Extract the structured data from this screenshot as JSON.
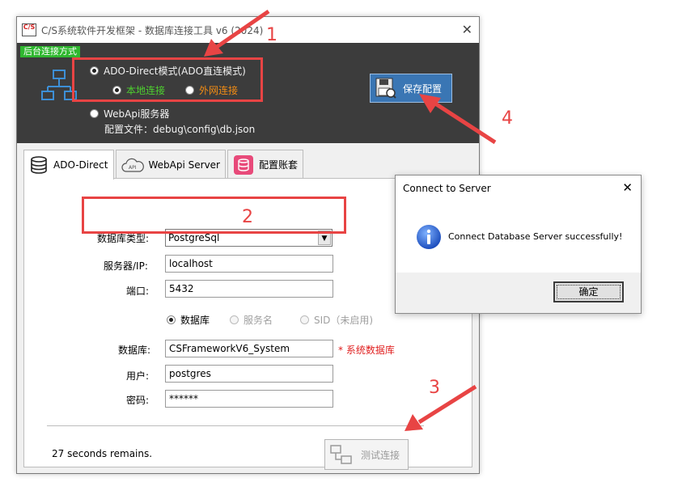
{
  "window": {
    "app_icon_text": "C/S",
    "title": "C/S系统软件开发框架 - 数据库连接工具 v6 (2024)",
    "close_glyph": "✕"
  },
  "header": {
    "mode_badge": "后台连接方式",
    "ado_direct_label": "ADO-Direct模式(ADO直连模式)",
    "local_label": "本地连接",
    "external_label": "外网连接",
    "webapi_label": "WebApi服务器",
    "config_file_line": "配置文件：debug\\config\\db.json",
    "save_button_label": "保存配置"
  },
  "tabs": [
    {
      "label": "ADO-Direct",
      "icon": "database-icon",
      "active": true
    },
    {
      "label": "WebApi Server",
      "icon": "cloud-api-icon",
      "active": false
    },
    {
      "label": "配置账套",
      "icon": "account-db-icon",
      "active": false
    }
  ],
  "form": {
    "db_type_label": "数据库类型:",
    "db_type_value": "PostgreSql",
    "server_label": "服务器/IP:",
    "server_value": "localhost",
    "port_label": "端口:",
    "port_value": "5432",
    "radio_database": "数据库",
    "radio_service": "服务名",
    "radio_sid": "SID（未启用)",
    "database_label": "数据库:",
    "database_value": "CSFrameworkV6_System",
    "database_hint": "* 系统数据库",
    "user_label": "用户:",
    "user_value": "postgres",
    "password_label": "密码:",
    "password_value": "******",
    "countdown": "27 seconds remains.",
    "test_button_label": "测试连接"
  },
  "dialog": {
    "title": "Connect to Server",
    "close_glyph": "✕",
    "message": "Connect Database Server successfully!",
    "ok_label": "确定"
  },
  "annotations": [
    "1",
    "2",
    "3",
    "4"
  ],
  "colors": {
    "annotation_red": "#e84444",
    "dark_panel": "#3c3c3c",
    "badge_green": "#2fb82f",
    "save_blue": "#3a76b4",
    "local_green": "#4ed12f",
    "external_orange": "#f28c14"
  }
}
